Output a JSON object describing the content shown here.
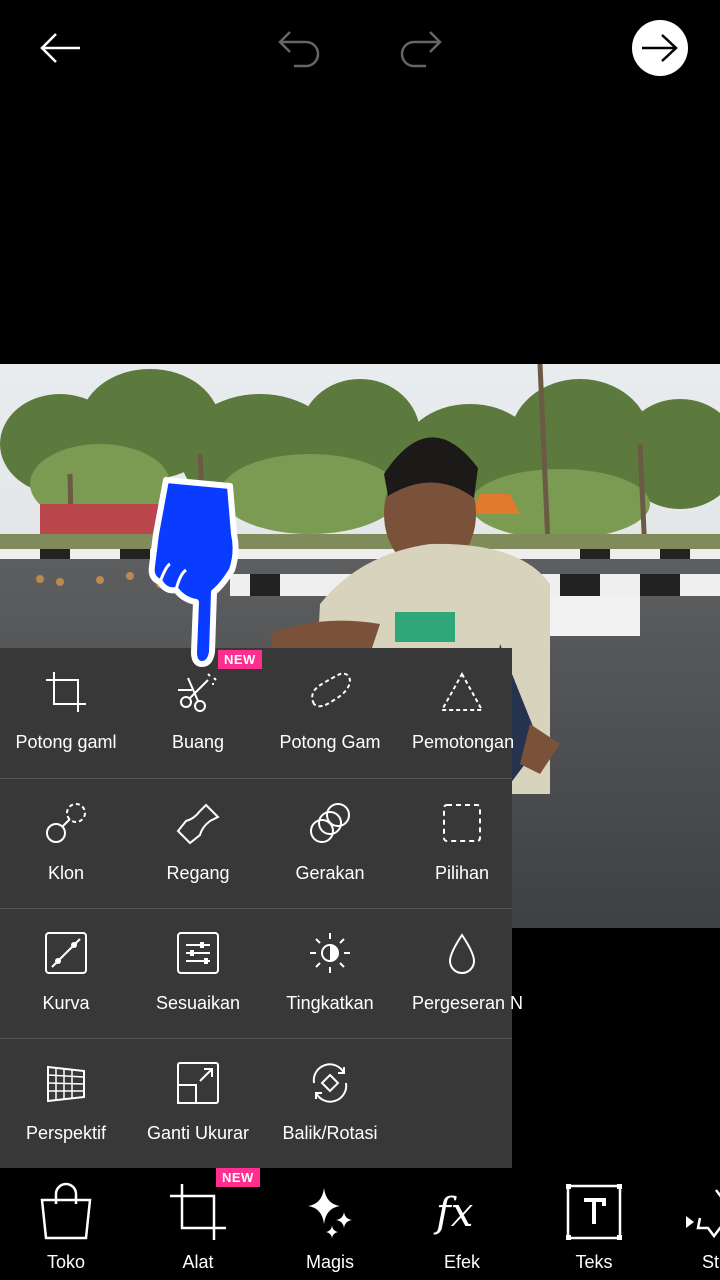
{
  "panel": {
    "rows": [
      [
        {
          "label": "Potong gaml",
          "icon": "crop-icon"
        },
        {
          "label": "Buang",
          "icon": "scissors-icon",
          "badge": "NEW"
        },
        {
          "label": "Potong Gam",
          "icon": "freecrop-icon"
        },
        {
          "label": "Pemotongan",
          "icon": "triangle-dashed-icon"
        }
      ],
      [
        {
          "label": "Klon",
          "icon": "clone-icon"
        },
        {
          "label": "Regang",
          "icon": "stretch-icon"
        },
        {
          "label": "Gerakan",
          "icon": "motion-icon"
        },
        {
          "label": "Pilihan",
          "icon": "selection-icon"
        }
      ],
      [
        {
          "label": "Kurva",
          "icon": "curves-icon"
        },
        {
          "label": "Sesuaikan",
          "icon": "adjust-icon"
        },
        {
          "label": "Tingkatkan",
          "icon": "enhance-icon"
        },
        {
          "label": "Pergeseran N",
          "icon": "drop-icon"
        }
      ],
      [
        {
          "label": "Perspektif",
          "icon": "perspective-icon"
        },
        {
          "label": "Ganti Ukurar",
          "icon": "resize-icon"
        },
        {
          "label": "Balik/Rotasi",
          "icon": "flip-rotate-icon"
        }
      ]
    ]
  },
  "tabs": [
    {
      "label": "Toko",
      "icon": "shopping-bag-icon"
    },
    {
      "label": "Alat",
      "icon": "crop-tool-icon",
      "badge": "NEW"
    },
    {
      "label": "Magis",
      "icon": "sparkles-icon"
    },
    {
      "label": "Efek",
      "icon": "fx-icon"
    },
    {
      "label": "Teks",
      "icon": "text-icon"
    },
    {
      "label": "St",
      "icon": "sticker-icon"
    }
  ],
  "colors": {
    "panel_bg": "#383838",
    "badge": "#ff2e8f",
    "hand": "#0a3cff"
  }
}
